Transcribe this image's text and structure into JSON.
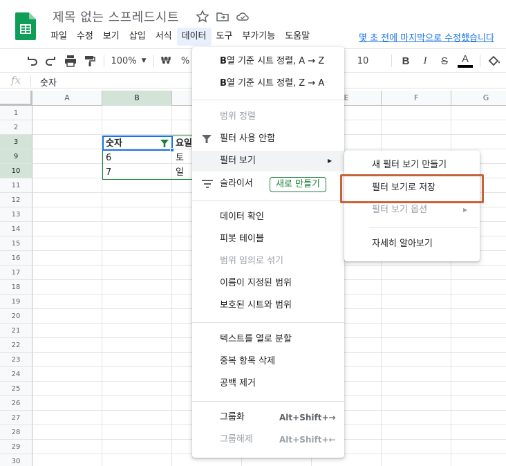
{
  "header": {
    "doc_title": "제목 없는 스프레드시트",
    "icons": [
      "star-icon",
      "move-to-folder-icon",
      "cloud-status-icon"
    ],
    "menus": [
      "파일",
      "수정",
      "보기",
      "삽입",
      "서식",
      "데이터",
      "도구",
      "부가기능",
      "도움말"
    ],
    "active_menu": "데이터",
    "last_edit": "몇 초 전에 마지막으로 수정했습니다"
  },
  "toolbar": {
    "zoom": "100%",
    "currency": "₩",
    "percent": "%",
    "font_size": "10",
    "bold": "B",
    "italic": "I",
    "strike": "S",
    "text_color": "A"
  },
  "formula_bar": {
    "fx": "fx",
    "value": "숫자"
  },
  "grid": {
    "columns": [
      "A",
      "B",
      "C",
      "D",
      "E",
      "F",
      "G"
    ],
    "selected_column": "B",
    "rows": [
      "1",
      "2",
      "3",
      "9",
      "10",
      "11",
      "12",
      "13",
      "14",
      "15",
      "16",
      "17",
      "18",
      "19",
      "20",
      "21",
      "22",
      "23",
      "24",
      "25",
      "26",
      "27",
      "28",
      "29",
      "30"
    ],
    "cells": {
      "b3": "숫자",
      "c3": "요일",
      "b9": "6",
      "c9": "토",
      "b10": "7",
      "c10": "일"
    }
  },
  "data_menu": {
    "sort_az_bold": "B",
    "sort_az": "열 기준 시트 정렬, A → Z",
    "sort_za_bold": "B",
    "sort_za": "열 기준 시트 정렬, Z → A",
    "range_sort": "범위 정렬",
    "filter_off": "필터 사용 안함",
    "filter_views": "필터 보기",
    "slicer": "슬라이서",
    "new_button": "새로 만들기",
    "data_validation": "데이터 확인",
    "pivot": "피봇 테이블",
    "randomize": "범위 임의로 섞기",
    "named_ranges": "이름이 지정된 범위",
    "protected": "보호된 시트와 범위",
    "split_text": "텍스트를 열로 분할",
    "remove_dupes": "중복 항목 삭제",
    "trim": "공백 제거",
    "group": "그룹화",
    "group_shortcut": "Alt+Shift+→",
    "ungroup": "그룹해제",
    "ungroup_shortcut": "Alt+Shift+←"
  },
  "submenu": {
    "create_new": "새 필터 보기 만들기",
    "save_as": "필터 보기로 저장",
    "options": "필터 보기 옵션",
    "learn_more": "자세히 알아보기"
  },
  "colors": {
    "accent_green": "#188038",
    "highlight_box": "#c7623a",
    "link_blue": "#1a73e8"
  }
}
